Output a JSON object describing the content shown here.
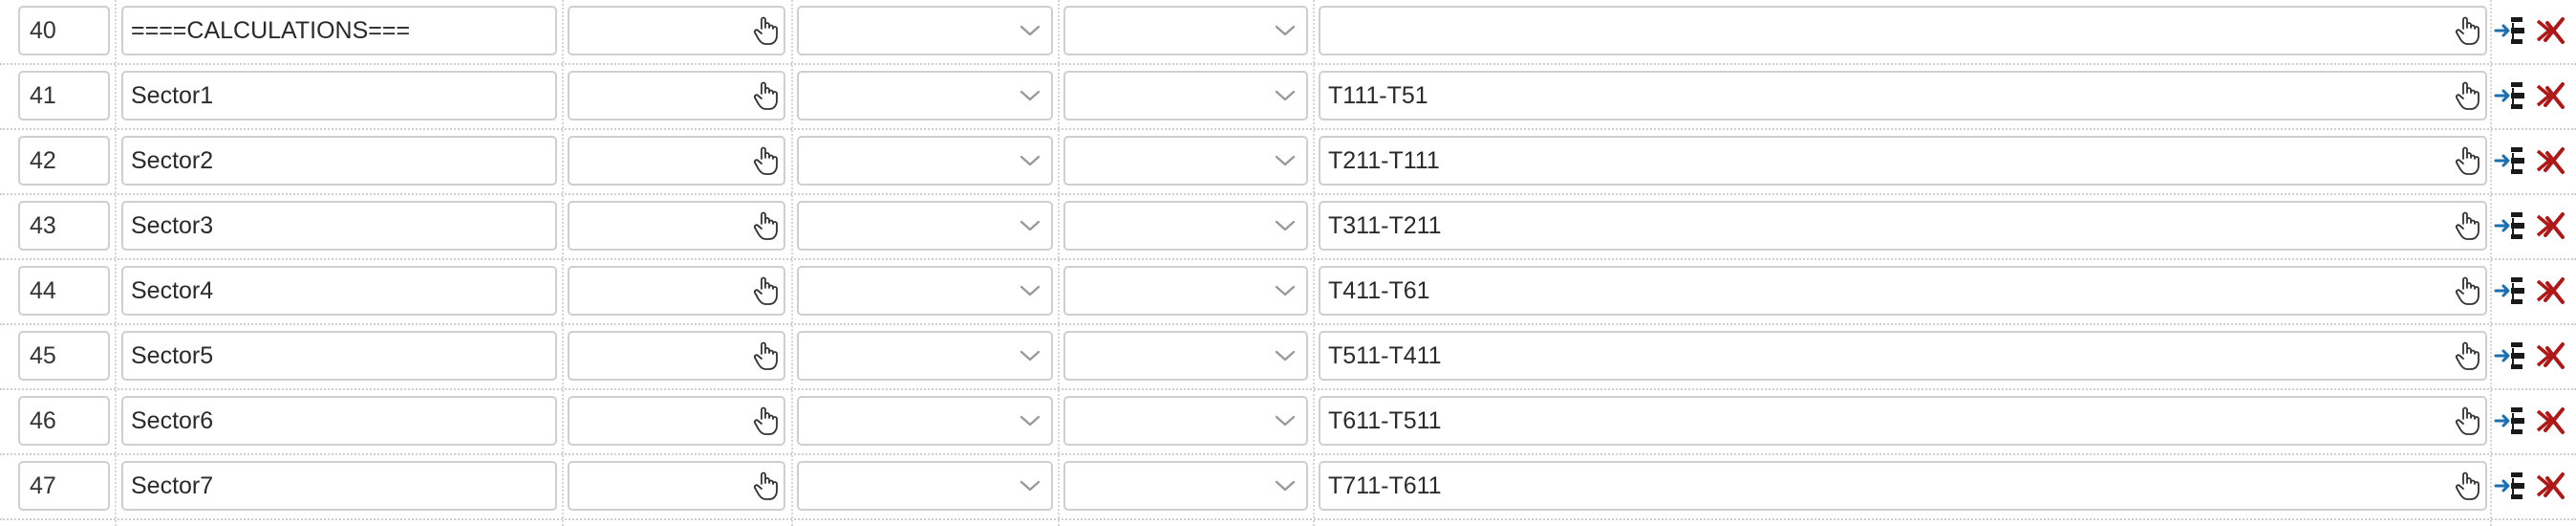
{
  "rows": [
    {
      "num": "40",
      "name": "====CALCULATIONS===",
      "formula": ""
    },
    {
      "num": "41",
      "name": "Sector1",
      "formula": "T111-T51"
    },
    {
      "num": "42",
      "name": "Sector2",
      "formula": "T211-T111"
    },
    {
      "num": "43",
      "name": "Sector3",
      "formula": "T311-T211"
    },
    {
      "num": "44",
      "name": "Sector4",
      "formula": "T411-T61"
    },
    {
      "num": "45",
      "name": "Sector5",
      "formula": "T511-T411"
    },
    {
      "num": "46",
      "name": "Sector6",
      "formula": "T611-T511"
    },
    {
      "num": "47",
      "name": "Sector7",
      "formula": "T711-T611"
    }
  ],
  "icons": {
    "picker": "hand-pointer-icon",
    "dropdown": "chevron-down-icon",
    "insert": "insert-row-icon",
    "delete": "delete-row-icon"
  },
  "colors": {
    "insert_arrow": "#1a6fb0",
    "delete_mark": "#b01818",
    "field_border": "#cfcfcf"
  }
}
